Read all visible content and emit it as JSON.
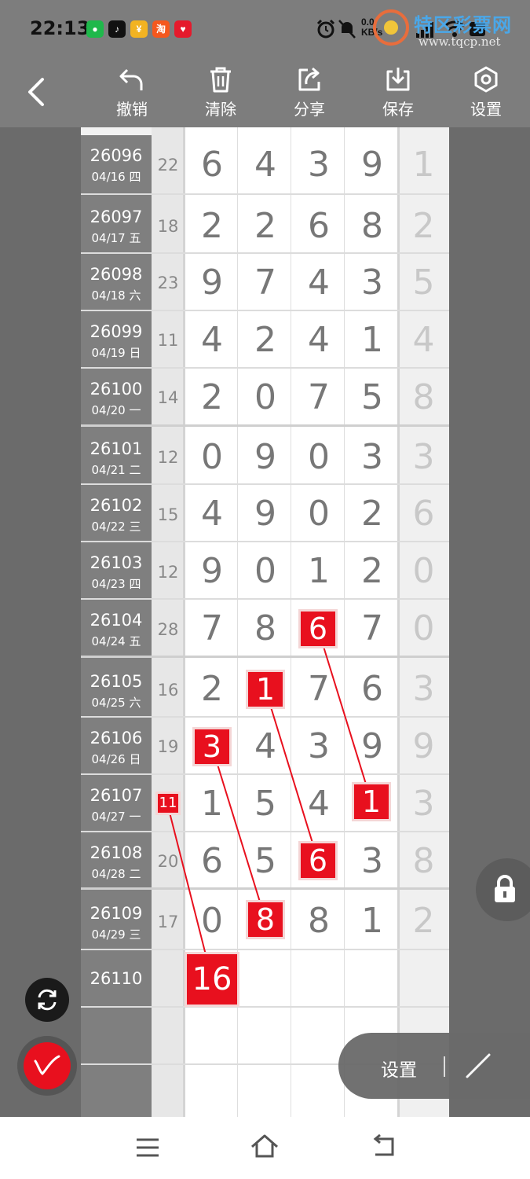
{
  "status_bar": {
    "time": "22:13",
    "net_speed": "0.0\nKB/s",
    "apps": [
      "wechat-icon",
      "tiktok-icon",
      "coin-app-icon",
      "taobao-icon",
      "gift-app-icon"
    ],
    "taobao_label": "淘",
    "watermark_title": "特区彩票网",
    "watermark_url": "www.tqcp.net"
  },
  "toolbar": {
    "undo_label": "撤销",
    "clear_label": "清除",
    "share_label": "分享",
    "save_label": "保存",
    "settings_label": "设置"
  },
  "rows": [
    {
      "issue": "26096",
      "date": "04/16 四",
      "sum": "22",
      "digits": [
        "6",
        "4",
        "3",
        "9"
      ],
      "extra": "1"
    },
    {
      "issue": "26097",
      "date": "04/17 五",
      "sum": "18",
      "digits": [
        "2",
        "2",
        "6",
        "8"
      ],
      "extra": "2"
    },
    {
      "issue": "26098",
      "date": "04/18 六",
      "sum": "23",
      "digits": [
        "9",
        "7",
        "4",
        "3"
      ],
      "extra": "5"
    },
    {
      "issue": "26099",
      "date": "04/19 日",
      "sum": "11",
      "digits": [
        "4",
        "2",
        "4",
        "1"
      ],
      "extra": "4"
    },
    {
      "issue": "26100",
      "date": "04/20 一",
      "sum": "14",
      "digits": [
        "2",
        "0",
        "7",
        "5"
      ],
      "extra": "8"
    },
    {
      "issue": "26101",
      "date": "04/21 二",
      "sum": "12",
      "digits": [
        "0",
        "9",
        "0",
        "3"
      ],
      "extra": "3"
    },
    {
      "issue": "26102",
      "date": "04/22 三",
      "sum": "15",
      "digits": [
        "4",
        "9",
        "0",
        "2"
      ],
      "extra": "6"
    },
    {
      "issue": "26103",
      "date": "04/23 四",
      "sum": "12",
      "digits": [
        "9",
        "0",
        "1",
        "2"
      ],
      "extra": "0"
    },
    {
      "issue": "26104",
      "date": "04/24 五",
      "sum": "28",
      "digits": [
        "7",
        "8",
        "6",
        "7"
      ],
      "extra": "0"
    },
    {
      "issue": "26105",
      "date": "04/25 六",
      "sum": "16",
      "digits": [
        "2",
        "1",
        "7",
        "6"
      ],
      "extra": "3"
    },
    {
      "issue": "26106",
      "date": "04/26 日",
      "sum": "19",
      "digits": [
        "3",
        "4",
        "3",
        "9"
      ],
      "extra": "9"
    },
    {
      "issue": "26107",
      "date": "04/27 一",
      "sum": "11",
      "digits": [
        "1",
        "5",
        "4",
        "1"
      ],
      "extra": "3"
    },
    {
      "issue": "26108",
      "date": "04/28 二",
      "sum": "20",
      "digits": [
        "6",
        "5",
        "6",
        "3"
      ],
      "extra": "8"
    },
    {
      "issue": "26109",
      "date": "04/29 三",
      "sum": "17",
      "digits": [
        "0",
        "8",
        "8",
        "1"
      ],
      "extra": "2"
    },
    {
      "issue": "26110",
      "date": "",
      "sum": "",
      "digits": [
        "",
        "",
        "",
        ""
      ],
      "extra": ""
    }
  ],
  "highlights": {
    "r8_d2": "6",
    "r9_d1": "1",
    "r10_d0": "3",
    "r11_sum": "11",
    "r11_d3": "1",
    "r12_d2": "6",
    "r13_d1": "8",
    "r14_d0": "16"
  },
  "floating": {
    "settings_label": "设置"
  },
  "colors": {
    "highlight": "#e8101e",
    "label_bg": "#7f7f7f",
    "toolbar_bg": "#7d7d7d"
  }
}
